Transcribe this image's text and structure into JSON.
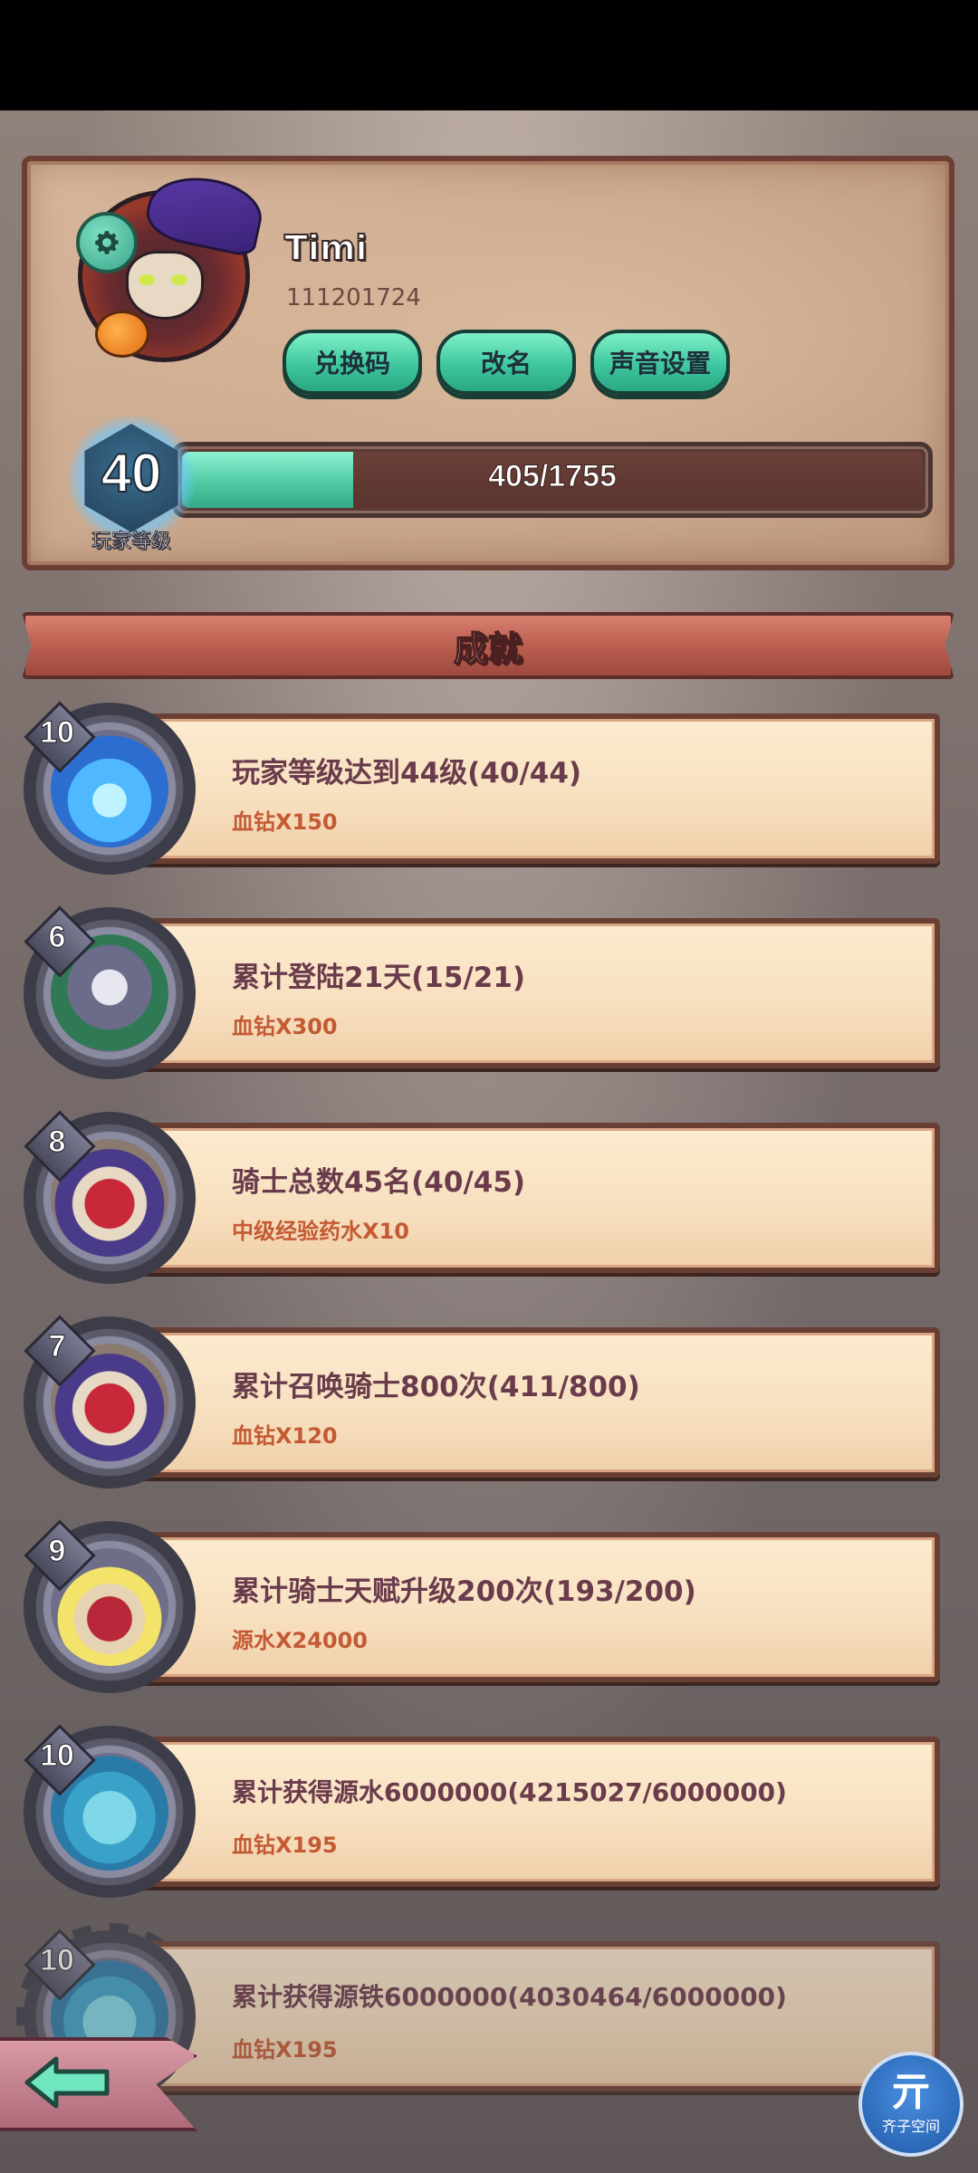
{
  "profile": {
    "name": "Timi",
    "uid": "111201724",
    "buttons": {
      "redeem": "兑换码",
      "rename": "改名",
      "sound": "声音设置"
    },
    "level": "40",
    "level_label": "玩家等级",
    "xp_text": "405/1755",
    "xp_fraction": 0.2308
  },
  "section_title": "成就",
  "achievements": [
    {
      "rank": "10",
      "title": "玩家等级达到44级(40/44)",
      "reward": "血钻X150",
      "icon": "blue-flame-icon"
    },
    {
      "rank": "6",
      "title": "累计登陆21天(15/21)",
      "reward": "血钻X300",
      "icon": "gear-crown-icon"
    },
    {
      "rank": "8",
      "title": "骑士总数45名(40/45)",
      "reward": "中级经验药水X10",
      "icon": "knights-icon"
    },
    {
      "rank": "7",
      "title": "累计召唤骑士800次(411/800)",
      "reward": "血钻X120",
      "icon": "knights-icon"
    },
    {
      "rank": "9",
      "title": "累计骑士天赋升级200次(193/200)",
      "reward": "源水X24000",
      "icon": "hat-knight-icon"
    },
    {
      "rank": "10",
      "title": "累计获得源水6000000(4215027/6000000)",
      "reward": "血钻X195",
      "icon": "blue-ore-icon"
    },
    {
      "rank": "10",
      "title": "累计获得源铁6000000(4030464/6000000)",
      "reward": "血钻X195",
      "icon": "blue-ore-icon"
    }
  ],
  "overlay": {
    "watermark_label": "齐子空间",
    "watermark_glyph": "亓"
  },
  "colors": {
    "accent_green": "#3ec79f",
    "reward_red": "#c45a34",
    "title_purple": "#6a3b4b"
  }
}
